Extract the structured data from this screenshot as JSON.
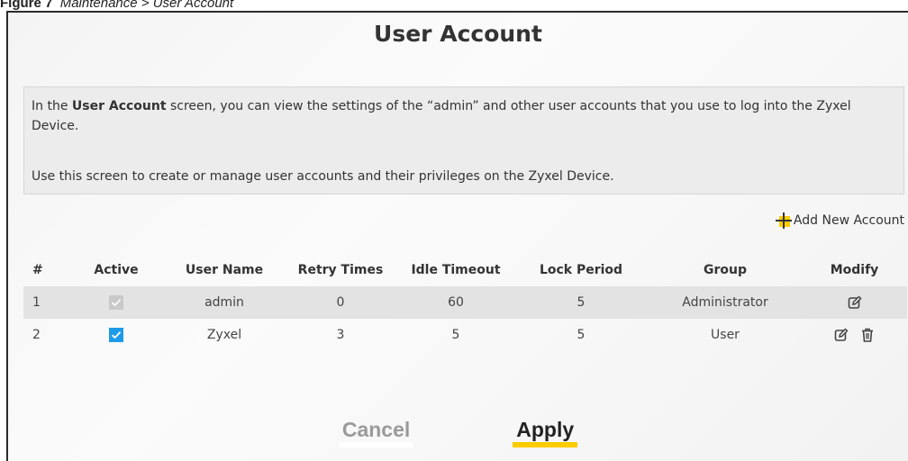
{
  "caption": {
    "figure_label": "Figure 7",
    "text": "Maintenance > User Account"
  },
  "page": {
    "title": "User Account"
  },
  "info": {
    "line1_prefix": "In the ",
    "line1_bold": "User Account",
    "line1_suffix": " screen, you can view the settings of the “admin” and other user accounts that you use to log into the Zyxel Device.",
    "line2": "Use this screen to create or manage user accounts and their privileges on the Zyxel Device."
  },
  "actions": {
    "add_label": "Add New Account",
    "add_icon": "plus-icon"
  },
  "table": {
    "columns": [
      "#",
      "Active",
      "User Name",
      "Retry Times",
      "Idle Timeout",
      "Lock Period",
      "Group",
      "Modify"
    ],
    "rows": [
      {
        "num": "1",
        "active": "checked-disabled",
        "user": "admin",
        "retry": "0",
        "idle": "60",
        "lock": "5",
        "group": "Administrator",
        "modify": [
          "edit-icon"
        ]
      },
      {
        "num": "2",
        "active": "checked",
        "user": "Zyxel",
        "retry": "3",
        "idle": "5",
        "lock": "5",
        "group": "User",
        "modify": [
          "edit-icon",
          "delete-icon"
        ]
      }
    ]
  },
  "buttons": {
    "cancel": "Cancel",
    "apply": "Apply"
  },
  "colors": {
    "accent": "#ffcc00",
    "checkbox_active": "#1e9be8",
    "checkbox_disabled": "#c9c9c9"
  }
}
